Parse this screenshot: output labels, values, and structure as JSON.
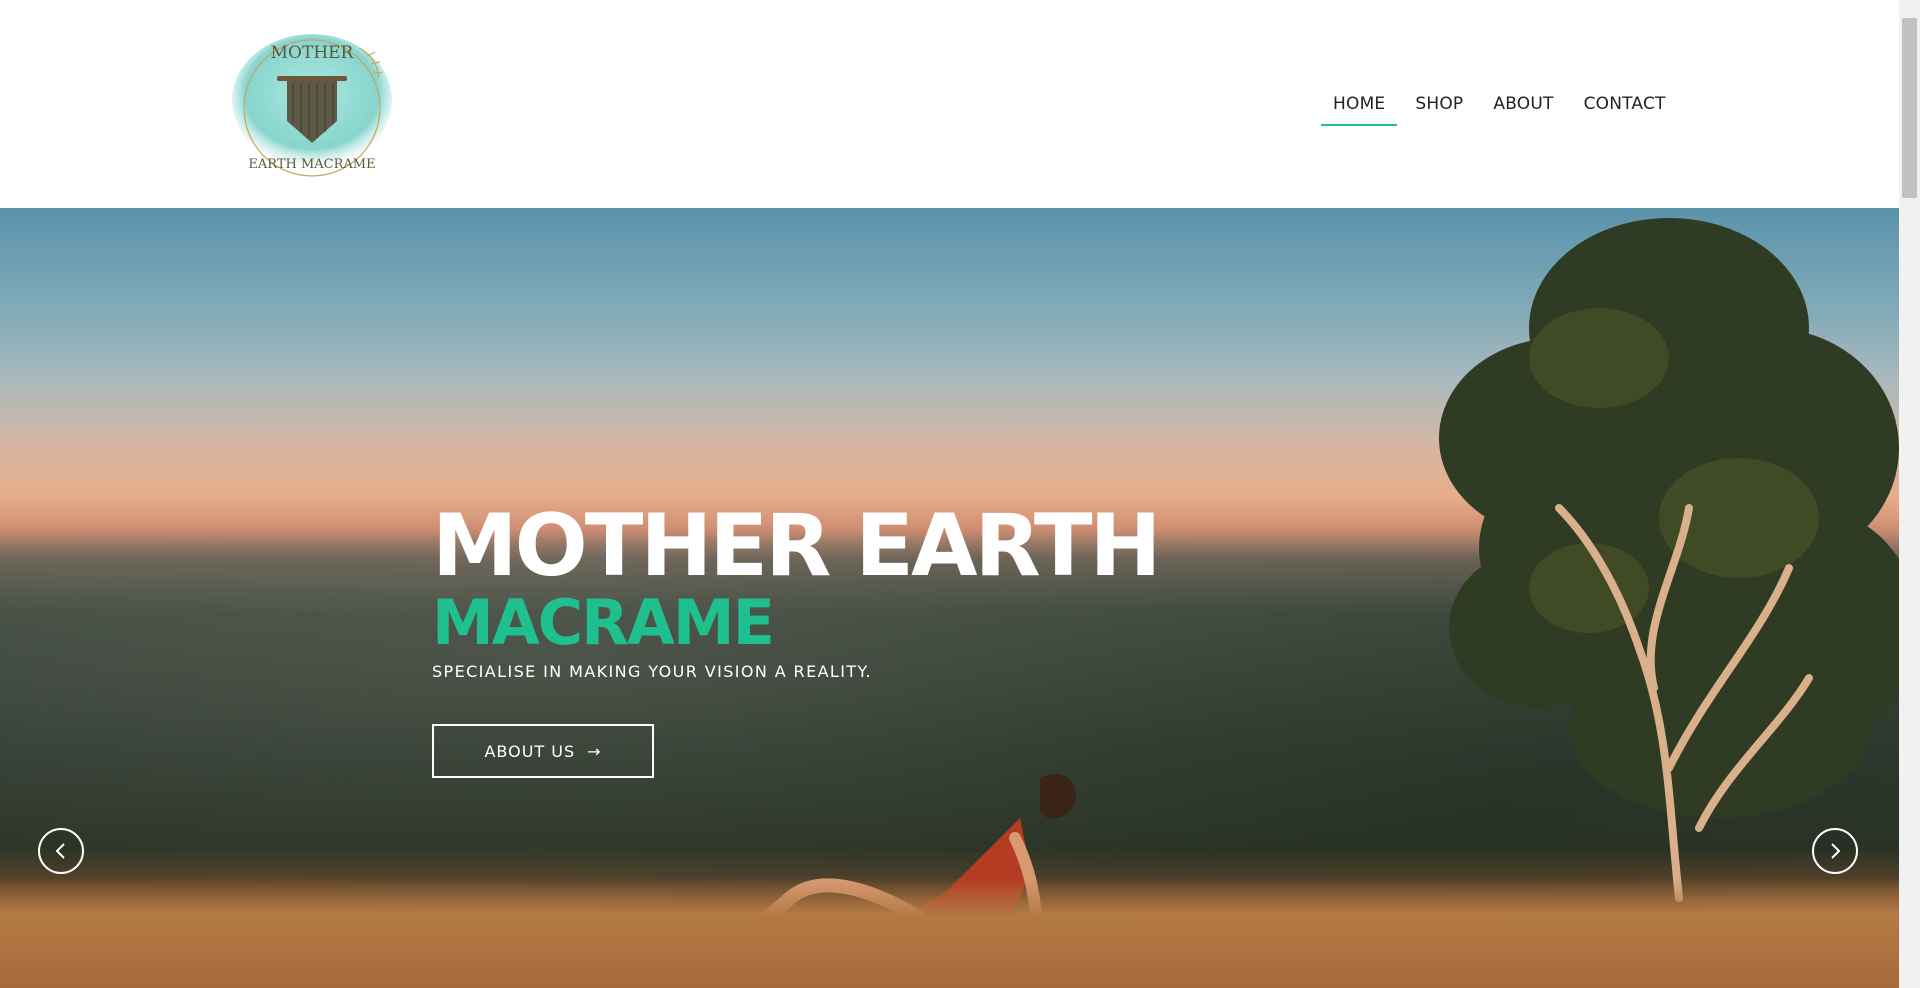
{
  "header": {
    "logo_alt": "Mother Earth Macrame",
    "logo_text_top": "MOTHER",
    "logo_text_bottom": "EARTH MACRAME",
    "nav": [
      {
        "label": "HOME",
        "active": true
      },
      {
        "label": "SHOP",
        "active": false
      },
      {
        "label": "ABOUT",
        "active": false
      },
      {
        "label": "CONTACT",
        "active": false
      }
    ]
  },
  "hero": {
    "title": "MOTHER EARTH",
    "subtitle": "MACRAME",
    "tagline": "SPECIALISE IN MAKING YOUR VISION A REALITY.",
    "button_label": "ABOUT US",
    "button_arrow": "→"
  },
  "colors": {
    "accent": "#1fbf8f",
    "text_dark": "#222222",
    "white": "#ffffff"
  },
  "icons": {
    "prev": "chevron-left-icon",
    "next": "chevron-right-icon"
  }
}
